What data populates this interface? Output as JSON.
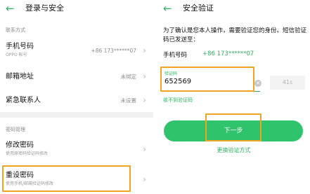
{
  "left_screen": {
    "back_icon": "arrow-left-icon",
    "title": "登录与安全",
    "section_contact": "联系方式",
    "phone": {
      "title": "手机号码",
      "sub": "OPPO 帐号",
      "value": "+86 173******07"
    },
    "email": {
      "title": "邮箱地址",
      "value": "未绑定"
    },
    "emergency": {
      "title": "紧急联系人",
      "value": "未设置"
    },
    "section_password": "密码管理",
    "change_password": {
      "title": "修改密码",
      "sub": "使用原密码验证码修改"
    },
    "reset_password": {
      "title": "重设密码",
      "sub": "使用手机/邮箱验证码修改"
    },
    "chevron": "›"
  },
  "right_screen": {
    "back_icon": "arrow-left-icon",
    "title": "安全验证",
    "intro": "为了确认是您本人操作，需要验证您的身份。短信验证码已发送至：",
    "phone_label": "手机号码",
    "phone_number": "+86 173******07",
    "code_label": "验证码",
    "code_value": "652569",
    "timer": "41s",
    "no_code_link": "收不到验证码",
    "next_button": "下一步",
    "switch_method_link": "更换验证方式"
  },
  "colors": {
    "accent": "#2bb35f",
    "button": "#2fc46c",
    "highlight": "#f0a424"
  }
}
